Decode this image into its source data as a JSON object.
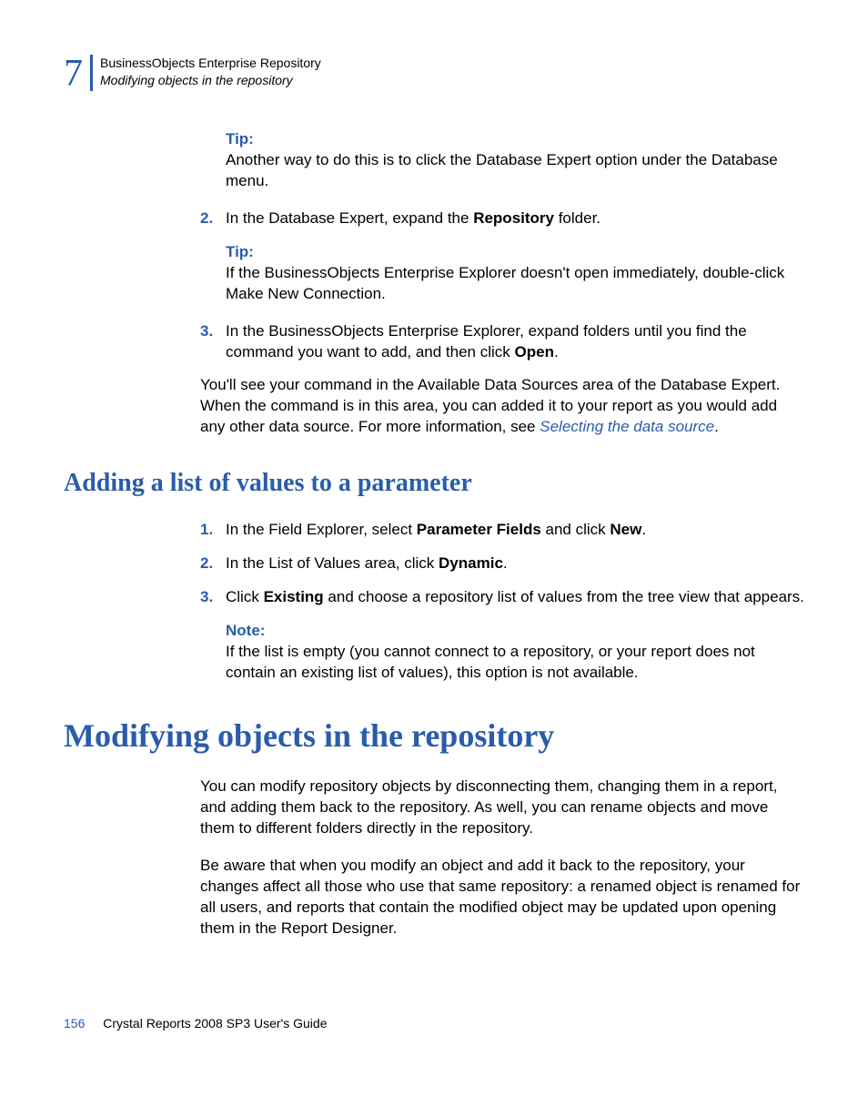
{
  "header": {
    "chapterNumber": "7",
    "chapterTitle": "BusinessObjects Enterprise Repository",
    "sectionTitle": "Modifying objects in the repository"
  },
  "tipLabel": "Tip:",
  "noteLabel": "Note:",
  "tip1": "Another way to do this is to click the Database Expert option under the Database menu.",
  "step2": {
    "num": "2.",
    "before": "In the Database Expert, expand the ",
    "bold": "Repository",
    "after": " folder."
  },
  "tip2": "If the BusinessObjects Enterprise Explorer doesn't open immediately, double-click Make New Connection.",
  "step3": {
    "num": "3.",
    "before": "In the BusinessObjects Enterprise Explorer, expand folders until you find the command you want to add, and then click ",
    "bold": "Open",
    "after": "."
  },
  "para1": {
    "before": "You'll see your command in the Available Data Sources area of the Database Expert. When the command is in this area, you can added it to your report as you would add any other data source. For more information, see ",
    "link": "Selecting the data source",
    "after": "."
  },
  "heading2": "Adding a list of values to a parameter",
  "list2": {
    "s1": {
      "num": "1.",
      "before": "In the Field Explorer, select ",
      "bold1": "Parameter Fields",
      "mid": " and click ",
      "bold2": "New",
      "after": "."
    },
    "s2": {
      "num": "2.",
      "before": "In the List of Values area, click ",
      "bold": "Dynamic",
      "after": "."
    },
    "s3": {
      "num": "3.",
      "before": "Click ",
      "bold": "Existing",
      "after": " and choose a repository list of values from the tree view that appears."
    }
  },
  "note1": "If the list is empty (you cannot connect to a repository, or your report does not contain an existing list of values), this option is not available.",
  "heading1": "Modifying objects in the repository",
  "para2": "You can modify repository objects by disconnecting them, changing them in a report, and adding them back to the repository. As well, you can rename objects and move them to different folders directly in the repository.",
  "para3": "Be aware that when you modify an object and add it back to the repository, your changes affect all those who use that same repository: a renamed object is renamed for all users, and reports that contain the modified object may be updated upon opening them in the Report Designer.",
  "footer": {
    "page": "156",
    "title": "Crystal Reports 2008 SP3 User's Guide"
  }
}
